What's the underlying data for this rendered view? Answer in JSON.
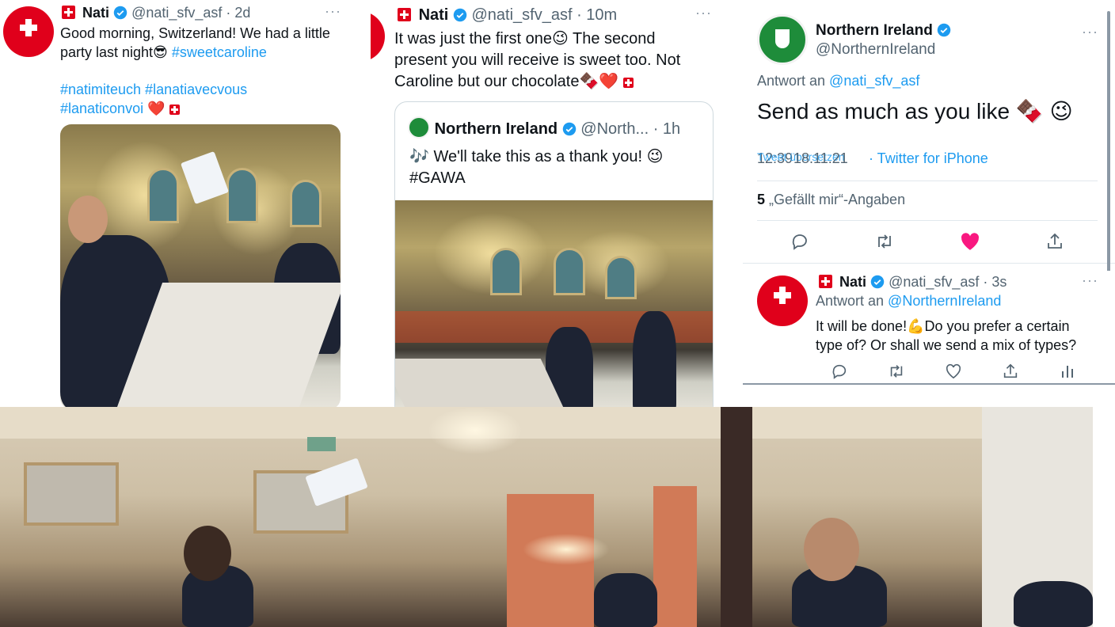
{
  "tweet1": {
    "name": "Nati",
    "handle": "@nati_sfv_asf",
    "time": "· 2d",
    "more": "···",
    "text_line1": "Good morning, Switzerland! We had a little",
    "text_line2_pre": "party last night😎 ",
    "hashtag1": "#sweetcaroline",
    "hashtags_line3": "#natimiteuch #lanatiavecvous",
    "hashtags_line4": "#lanaticonvoi",
    "heart": "❤️"
  },
  "tweet2": {
    "name": "Nati",
    "handle": "@nati_sfv_asf",
    "time": "· 10m",
    "more": "···",
    "text_line1": "It was just the first one😉 The second",
    "text_line2": "present you will receive is sweet too. Not",
    "text_line3": "Caroline but our chocolate🍫❤️",
    "quote": {
      "name": "Northern Ireland",
      "handle": "@North...",
      "time": "· 1h",
      "text_line1": "🎶 We'll take this as a thank you! 😉",
      "text_line2": "#GAWA"
    }
  },
  "tweet3": {
    "name": "Northern Ireland",
    "handle": "@NorthernIreland",
    "more": "···",
    "reply_prefix": "Antwort an ",
    "reply_to": "@nati_sfv_asf",
    "text": "Send as much as you like 🍫 😉",
    "meta_time_overlap_a": "12:39",
    "meta_time_overlap_b": "Tweet übersetzen",
    "meta_time_overlap_c": "18.11.21",
    "meta_source": "· Twitter for iPhone",
    "likes_count": "5",
    "likes_label": " „Gefällt mir“-Angaben",
    "liked_color": "#f91880"
  },
  "tweet4": {
    "name": "Nati",
    "handle": "@nati_sfv_asf",
    "time": "· 3s",
    "more": "···",
    "reply_prefix": "Antwort an ",
    "reply_to": "@NorthernIreland",
    "text_line1": "It will be done!💪Do you prefer a certain",
    "text_line2": "type of? Or shall we send a mix of types?"
  },
  "colors": {
    "accent": "#1d9bf0",
    "swiss_red": "#e0001b",
    "muted": "#536471"
  },
  "icons": [
    "reply-icon",
    "retweet-icon",
    "like-icon",
    "share-icon",
    "analytics-icon",
    "verified-badge-icon",
    "more-icon"
  ]
}
